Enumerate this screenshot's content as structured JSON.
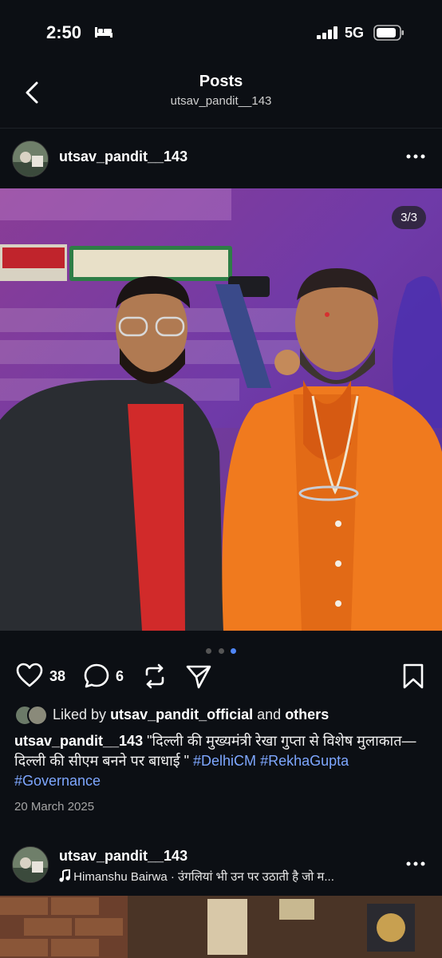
{
  "status_bar": {
    "time": "2:50",
    "network": "5G"
  },
  "header": {
    "title": "Posts",
    "subtitle": "utsav_pandit__143"
  },
  "post": {
    "username": "utsav_pandit__143",
    "media_counter": "3/3",
    "carousel": {
      "total": 3,
      "active_index": 2
    },
    "likes_count": "38",
    "comments_count": "6",
    "liked_by_prefix": "Liked by",
    "liked_by_user": "utsav_pandit_official",
    "liked_by_and": "and",
    "liked_by_others": "others",
    "caption_user": "utsav_pandit__143",
    "caption_text": "\"दिल्ली की मुख्यमंत्री रेखा गुप्ता से विशेष मुलाकात—दिल्ली की सीएम बनने पर बाधाई \"",
    "hashtags": [
      "#DelhiCM",
      "#RekhaGupta",
      "#Governance"
    ],
    "date": "20 March 2025"
  },
  "next_post": {
    "username": "utsav_pandit__143",
    "music_text": "Himanshu Bairwa · उंगलियां भी उन पर उठाती है जो म..."
  },
  "colors": {
    "background": "#0c0f14",
    "hashtag": "#7ea7ff",
    "active_dot": "#4f86f7",
    "vest": "#f07a1e"
  },
  "icons": [
    "bed-icon",
    "signal-icon",
    "battery-icon",
    "back-icon",
    "more-icon",
    "heart-icon",
    "comment-icon",
    "repost-icon",
    "share-icon",
    "bookmark-icon",
    "music-note-icon"
  ]
}
